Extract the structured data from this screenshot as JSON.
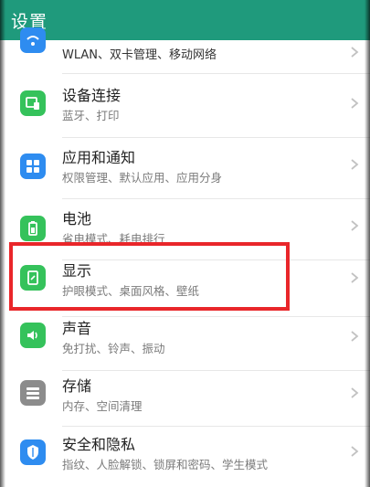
{
  "header": {
    "title": "设置"
  },
  "items": [
    {
      "label": "",
      "subtitle": "WLAN、双卡管理、移动网络"
    },
    {
      "label": "设备连接",
      "subtitle": "蓝牙、打印"
    },
    {
      "label": "应用和通知",
      "subtitle": "权限管理、默认应用、应用分身"
    },
    {
      "label": "电池",
      "subtitle": "省电模式、耗电排行"
    },
    {
      "label": "显示",
      "subtitle": "护眼模式、桌面风格、壁纸"
    },
    {
      "label": "声音",
      "subtitle": "免打扰、铃声、振动"
    },
    {
      "label": "存储",
      "subtitle": "内存、空间清理"
    },
    {
      "label": "安全和隐私",
      "subtitle": "指纹、人脸解锁、锁屏和密码、学生模式"
    }
  ],
  "icons": {
    "network": "wifi-icon",
    "device_connection": "device-connection-icon",
    "apps": "apps-grid-icon",
    "battery": "battery-icon",
    "display": "display-icon",
    "sound": "speaker-icon",
    "storage": "storage-icon",
    "security": "shield-icon"
  },
  "colors": {
    "app_bar": "#1f9a7c",
    "icon_blue": "#2e8cf0",
    "icon_green": "#35c25b",
    "icon_gray": "#8c8c8c",
    "highlight": "#e9262a"
  }
}
